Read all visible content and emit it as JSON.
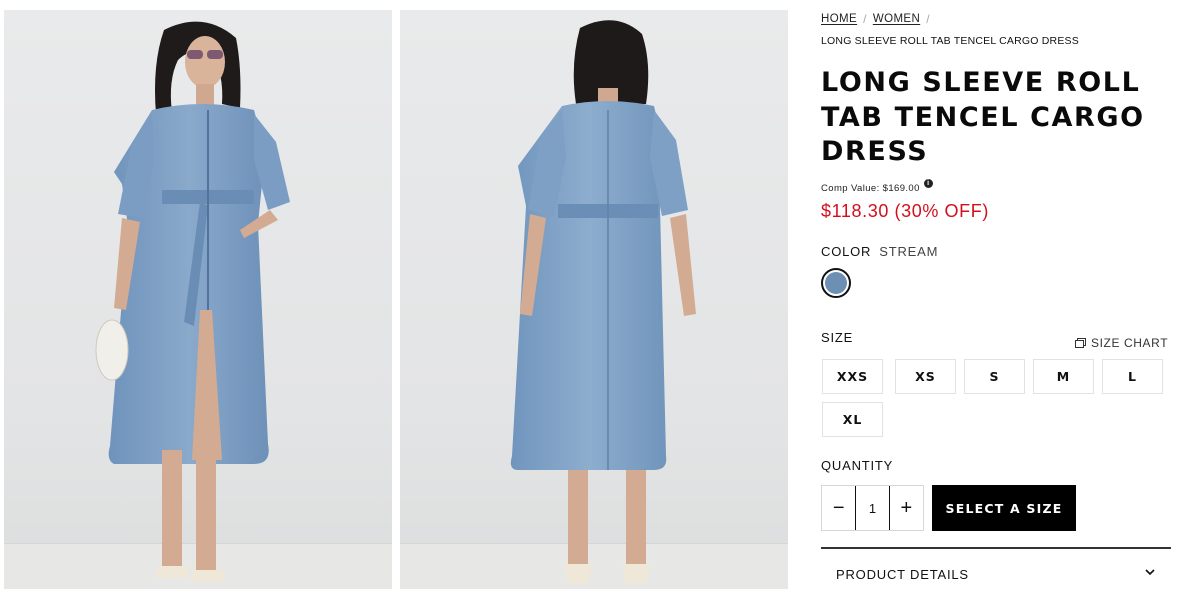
{
  "breadcrumb": {
    "items": [
      "HOME",
      "WOMEN"
    ],
    "current": "LONG SLEEVE ROLL TAB TENCEL CARGO DRESS"
  },
  "product": {
    "title": "LONG SLEEVE ROLL TAB TENCEL CARGO DRESS",
    "comp_value": "Comp Value: $169.00",
    "sale_price": "$118.30 (30% OFF)",
    "sale_color": "#d2101c"
  },
  "color": {
    "label": "COLOR",
    "selected": "STREAM",
    "swatch_hex": "#6d8fb3"
  },
  "size": {
    "label": "SIZE",
    "chart_label": "SIZE CHART",
    "options": [
      "XXS",
      "XS",
      "S",
      "M",
      "L",
      "XL"
    ]
  },
  "quantity": {
    "label": "QUANTITY",
    "value": "1",
    "minus": "−",
    "plus": "+"
  },
  "cta": {
    "label": "SELECT A SIZE"
  },
  "accordion": {
    "product_details": "PRODUCT DETAILS"
  },
  "icons": {
    "info": "info-icon",
    "size_chart": "size-chart-icon",
    "expand": "chevron-down-icon"
  }
}
